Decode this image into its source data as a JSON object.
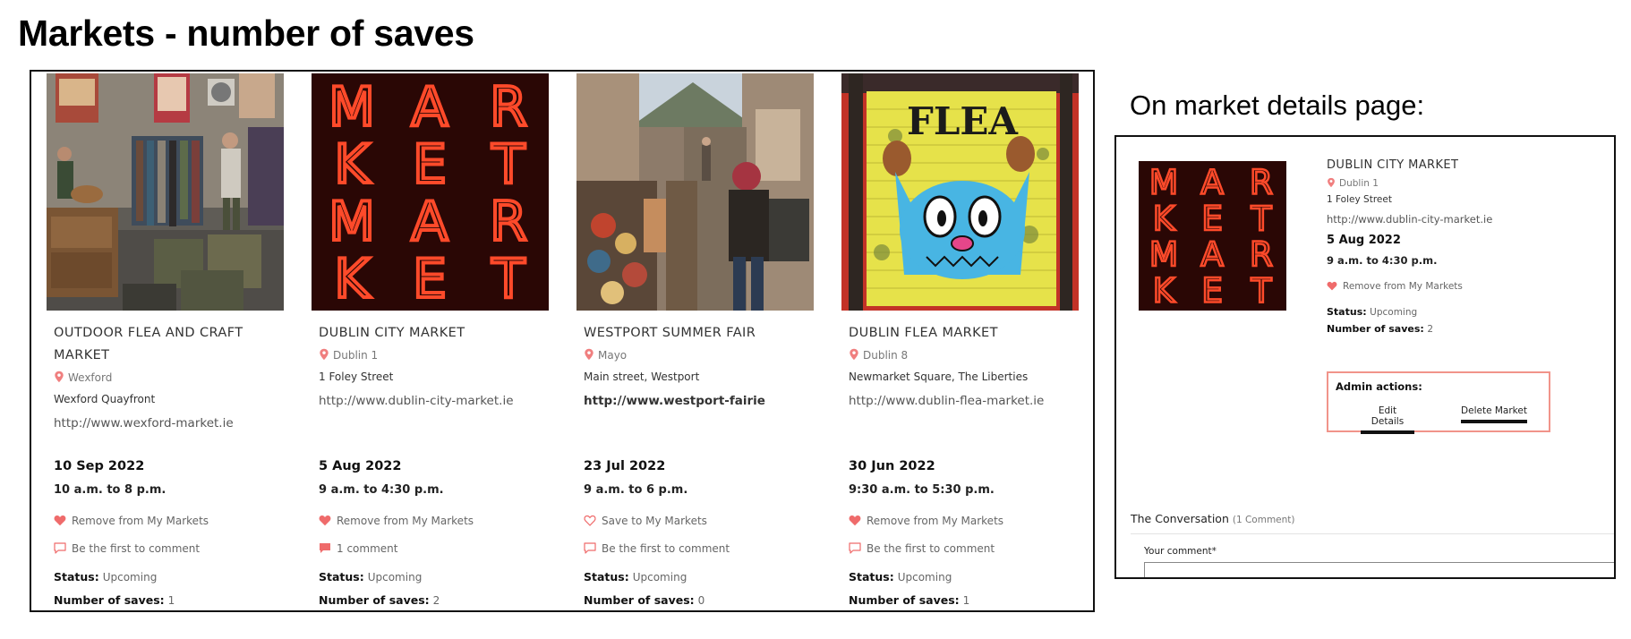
{
  "title": "Markets - number of saves",
  "colors": {
    "accent": "#f07f7f",
    "heart": "#ef6b6b",
    "admin_border": "#f1948a"
  },
  "markets": [
    {
      "name_lines": [
        "OUTDOOR FLEA AND CRAFT",
        "MARKET"
      ],
      "location": "Wexford",
      "address": "Wexford Quayfront",
      "url": "http://www.wexford-market.ie",
      "date": "10 Sep 2022",
      "time": "10 a.m. to 8 p.m.",
      "save_label": "Remove from My Markets",
      "saved": true,
      "comment_label": "Be the first to comment",
      "status_label": "Status:",
      "status_value": "Upcoming",
      "saves_label": "Number of saves:",
      "saves_value": "1",
      "image_icon": "flea-market-photo"
    },
    {
      "name_lines": [
        "DUBLIN CITY MARKET"
      ],
      "location": "Dublin 1",
      "address": "1 Foley Street",
      "url": "http://www.dublin-city-market.ie",
      "date": "5 Aug 2022",
      "time": "9 a.m. to 4:30 p.m.",
      "save_label": "Remove from My Markets",
      "saved": true,
      "comment_label": "1 comment",
      "status_label": "Status:",
      "status_value": "Upcoming",
      "saves_label": "Number of saves:",
      "saves_value": "2",
      "image_icon": "neon-market-sign"
    },
    {
      "name_lines": [
        "WESTPORT SUMMER FAIR"
      ],
      "location": "Mayo",
      "address": "Main street, Westport",
      "url": "http://www.westport-fairie",
      "date": "23 Jul 2022",
      "time": "9 a.m. to 6 p.m.",
      "save_label": "Save to My Markets",
      "saved": false,
      "comment_label": "Be the first to comment",
      "status_label": "Status:",
      "status_value": "Upcoming",
      "saves_label": "Number of saves:",
      "saves_value": "0",
      "image_icon": "street-bazaar-photo"
    },
    {
      "name_lines": [
        "DUBLIN FLEA MARKET"
      ],
      "location": "Dublin 8",
      "address": "Newmarket Square, The Liberties",
      "url": "http://www.dublin-flea-market.ie",
      "date": "30 Jun 2022",
      "time": "9:30 a.m. to 5:30 p.m.",
      "save_label": "Remove from My Markets",
      "saved": true,
      "comment_label": "Be the first to comment",
      "status_label": "Status:",
      "status_value": "Upcoming",
      "saves_label": "Number of saves:",
      "saves_value": "1",
      "image_icon": "flea-graffiti-door"
    }
  ],
  "details": {
    "heading": "On market details page:",
    "name": "DUBLIN CITY MARKET",
    "location": "Dublin 1",
    "address": "1 Foley Street",
    "url": "http://www.dublin-city-market.ie",
    "date": "5 Aug 2022",
    "time": "9 a.m. to 4:30 p.m.",
    "save_label": "Remove from My Markets",
    "status_label": "Status:",
    "status_value": "Upcoming",
    "saves_label": "Number of saves:",
    "saves_value": "2",
    "admin_title": "Admin actions:",
    "edit_label": "Edit Details",
    "delete_label": "Delete Market",
    "conversation_title": "The Conversation",
    "conversation_count": "(1 Comment)",
    "comment_label": "Your comment*"
  },
  "neon_sign": {
    "letters": [
      [
        "M",
        "A",
        "R"
      ],
      [
        "K",
        "E",
        "T"
      ],
      [
        "M",
        "A",
        "R"
      ],
      [
        "K",
        "E",
        "T"
      ]
    ]
  },
  "flea_door": {
    "word": "FLEA"
  }
}
